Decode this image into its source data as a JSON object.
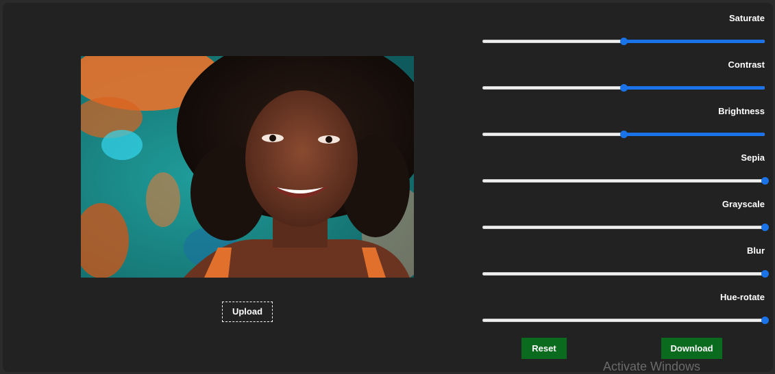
{
  "upload": {
    "label": "Upload"
  },
  "filters": [
    {
      "label": "Saturate",
      "value_fraction": 0.5
    },
    {
      "label": "Contrast",
      "value_fraction": 0.5
    },
    {
      "label": "Brightness",
      "value_fraction": 0.5
    },
    {
      "label": "Sepia",
      "value_fraction": 1.0
    },
    {
      "label": "Grayscale",
      "value_fraction": 1.0
    },
    {
      "label": "Blur",
      "value_fraction": 1.0
    },
    {
      "label": "Hue-rotate",
      "value_fraction": 1.0
    }
  ],
  "actions": {
    "reset_label": "Reset",
    "download_label": "Download"
  },
  "watermark": {
    "text": "Activate Windows"
  },
  "colors": {
    "background": "#222222",
    "accent": "#1a73e8",
    "button": "#0a6b1e",
    "track": "#f0f0f0"
  },
  "icons": {
    "photo": "portrait-photo"
  }
}
